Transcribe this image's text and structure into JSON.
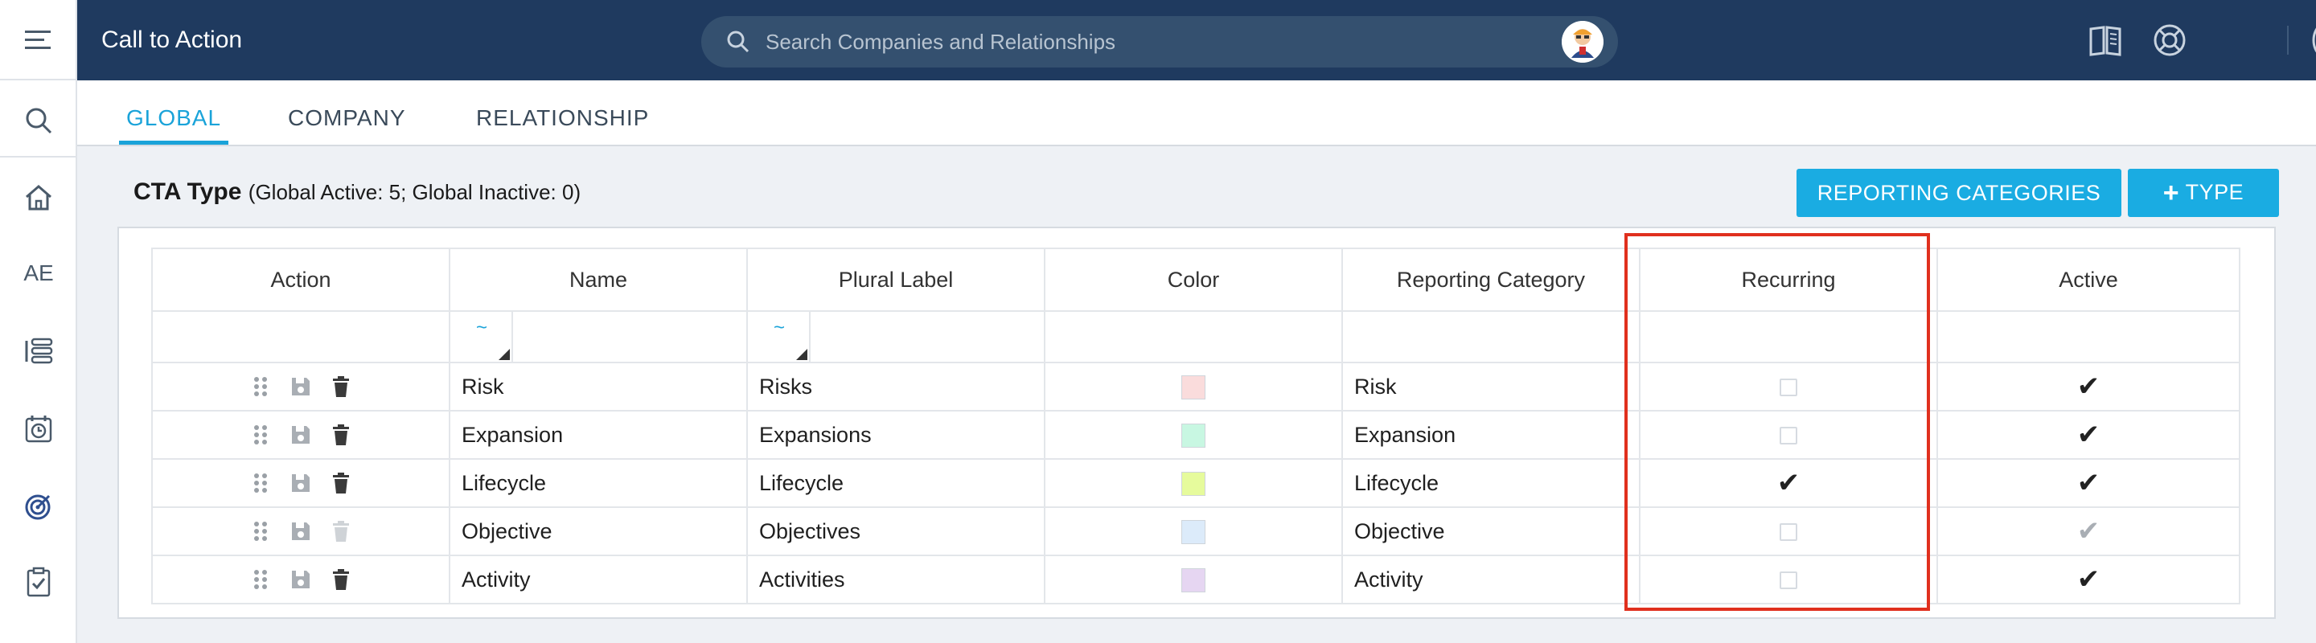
{
  "header": {
    "title": "Call to Action",
    "search_placeholder": "Search Companies and Relationships"
  },
  "sidebar": {
    "items": [
      {
        "icon": "menu-icon"
      },
      {
        "icon": "search-icon"
      },
      {
        "icon": "home-icon"
      },
      {
        "label": "AE"
      },
      {
        "icon": "timeline-icon"
      },
      {
        "icon": "calendar-clock-icon"
      },
      {
        "icon": "target-icon"
      },
      {
        "icon": "clipboard-check-icon"
      }
    ]
  },
  "tabs": [
    {
      "label": "GLOBAL",
      "active": true
    },
    {
      "label": "COMPANY",
      "active": false
    },
    {
      "label": "RELATIONSHIP",
      "active": false
    }
  ],
  "cta": {
    "title": "CTA Type",
    "subtitle": "(Global Active: 5; Global Inactive: 0)"
  },
  "buttons": {
    "reporting_categories": "REPORTING CATEGORIES",
    "add_type": "TYPE"
  },
  "table": {
    "columns": [
      "Action",
      "Name",
      "Plural Label",
      "Color",
      "Reporting Category",
      "Recurring",
      "Active"
    ],
    "filter_symbol": "~",
    "rows": [
      {
        "name": "Risk",
        "plural": "Risks",
        "color": "#fadcdc",
        "category": "Risk",
        "recurring": false,
        "active": true,
        "active_dim": false,
        "delete_dim": false
      },
      {
        "name": "Expansion",
        "plural": "Expansions",
        "color": "#c8f7e2",
        "category": "Expansion",
        "recurring": false,
        "active": true,
        "active_dim": false,
        "delete_dim": false
      },
      {
        "name": "Lifecycle",
        "plural": "Lifecycle",
        "color": "#e6fb9c",
        "category": "Lifecycle",
        "recurring": true,
        "active": true,
        "active_dim": false,
        "delete_dim": false
      },
      {
        "name": "Objective",
        "plural": "Objectives",
        "color": "#dcebfa",
        "category": "Objective",
        "recurring": false,
        "active": true,
        "active_dim": true,
        "delete_dim": true
      },
      {
        "name": "Activity",
        "plural": "Activities",
        "color": "#e6d6f2",
        "category": "Activity",
        "recurring": false,
        "active": true,
        "active_dim": false,
        "delete_dim": false
      }
    ]
  },
  "colors": {
    "header_bg": "#1f3a5f",
    "accent": "#1aace2",
    "highlight": "#e0301e"
  }
}
